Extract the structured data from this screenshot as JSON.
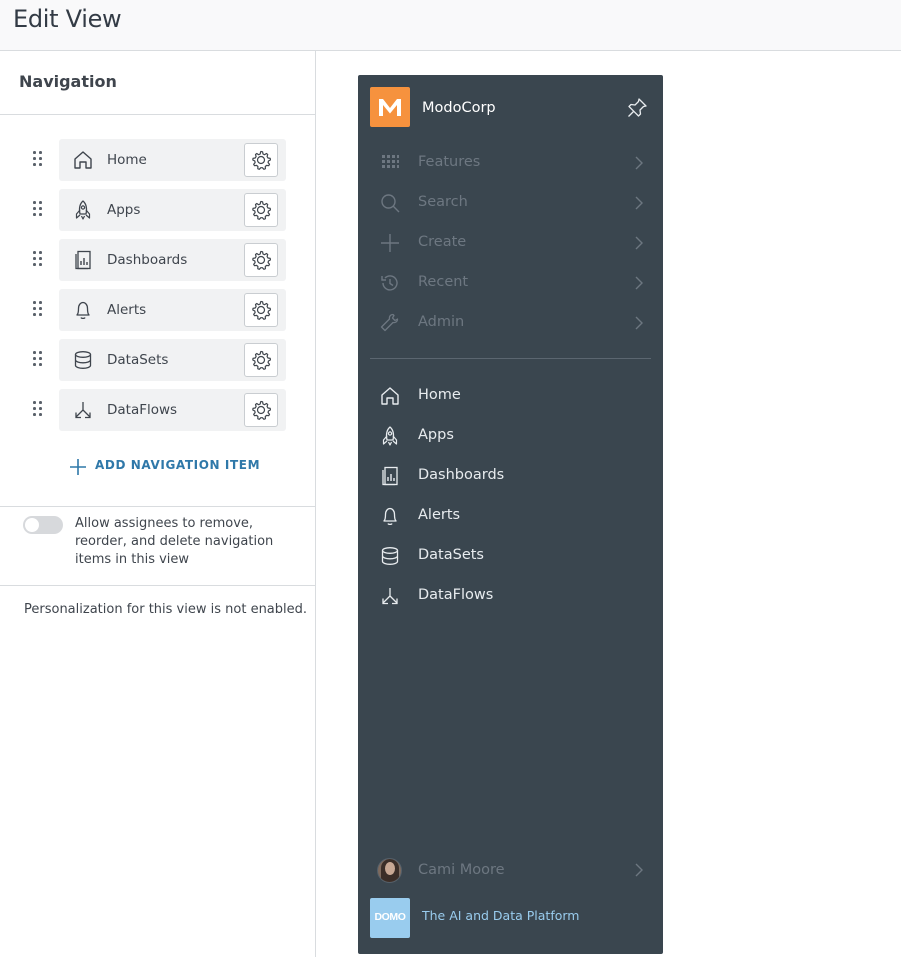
{
  "header": {
    "title": "Edit View"
  },
  "navigation": {
    "title": "Navigation",
    "items": [
      {
        "label": "Home",
        "icon": "home-icon"
      },
      {
        "label": "Apps",
        "icon": "rocket-icon"
      },
      {
        "label": "Dashboards",
        "icon": "dashboard-icon"
      },
      {
        "label": "Alerts",
        "icon": "bell-icon"
      },
      {
        "label": "DataSets",
        "icon": "database-icon"
      },
      {
        "label": "DataFlows",
        "icon": "dataflow-icon"
      }
    ],
    "add_label": "ADD NAVIGATION ITEM",
    "allow_toggle": {
      "on": false,
      "label": "Allow assignees to remove, reorder, and delete navigation items in this view"
    },
    "personalization_note": "Personalization for this view is not enabled."
  },
  "preview": {
    "org_name": "ModoCorp",
    "logo_letter": "M",
    "system_items": [
      {
        "label": "Features",
        "icon": "grid-icon"
      },
      {
        "label": "Search",
        "icon": "search-icon"
      },
      {
        "label": "Create",
        "icon": "plus-icon"
      },
      {
        "label": "Recent",
        "icon": "history-icon"
      },
      {
        "label": "Admin",
        "icon": "wrench-icon"
      }
    ],
    "nav_items": [
      {
        "label": "Home",
        "icon": "home-icon"
      },
      {
        "label": "Apps",
        "icon": "rocket-icon"
      },
      {
        "label": "Dashboards",
        "icon": "dashboard-icon"
      },
      {
        "label": "Alerts",
        "icon": "bell-icon"
      },
      {
        "label": "DataSets",
        "icon": "database-icon"
      },
      {
        "label": "DataFlows",
        "icon": "dataflow-icon"
      }
    ],
    "user_name": "Cami Moore",
    "brand_logo_text": "DOMO",
    "brand_tagline": "The AI and Data Platform"
  },
  "colors": {
    "sidebar_bg": "#3a464f",
    "logo_orange": "#f6923e",
    "link_blue": "#2f78a9",
    "domo_blue": "#99ccee"
  }
}
